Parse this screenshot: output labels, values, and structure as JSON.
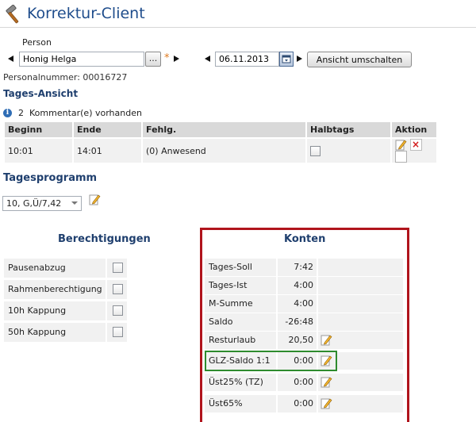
{
  "window": {
    "title": "Korrektur-Client"
  },
  "person": {
    "label": "Person",
    "value": "Honig Helga",
    "lookup_label": "...",
    "required_mark": "*"
  },
  "date": {
    "value": "06.11.2013"
  },
  "toggle_view_label": "Ansicht umschalten",
  "personnel_number": "Personalnummer: 00016727",
  "day_view": {
    "heading": "Tages-Ansicht",
    "info_icon_glyph": "i",
    "comment_count": "2",
    "comment_text": "Kommentar(e) vorhanden",
    "columns": [
      "Beginn",
      "Ende",
      "Fehlg.",
      "Halbtags",
      "Aktion"
    ],
    "rows": [
      {
        "begin": "10:01",
        "end": "14:01",
        "absence": "(0) Anwesend",
        "half_day": false
      }
    ]
  },
  "program": {
    "heading": "Tagesprogramm",
    "selected": "10, G,Ü/7,42"
  },
  "permissions": {
    "heading": "Berechtigungen",
    "items": [
      {
        "label": "Pausenabzug",
        "checked": false
      },
      {
        "label": "Rahmenberechtigung",
        "checked": false
      },
      {
        "label": "10h Kappung",
        "checked": false
      },
      {
        "label": "50h Kappung",
        "checked": false
      }
    ]
  },
  "accounts": {
    "heading": "Konten",
    "items": [
      {
        "label": "Tages-Soll",
        "value": "7:42",
        "editable": false
      },
      {
        "label": "Tages-Ist",
        "value": "4:00",
        "editable": false
      },
      {
        "label": "M-Summe",
        "value": "4:00",
        "editable": false
      },
      {
        "label": "Saldo",
        "value": "-26:48",
        "editable": false
      },
      {
        "label": "Resturlaub",
        "value": "20,50",
        "editable": true
      },
      {
        "label": "GLZ-Saldo 1:1",
        "value": "0:00",
        "editable": true
      },
      {
        "label": "Üst25% (TZ)",
        "value": "0:00",
        "editable": true
      },
      {
        "label": "Üst65%",
        "value": "0:00",
        "editable": true
      }
    ]
  },
  "colors": {
    "title": "#1f4d8c",
    "heading": "#1f3f6e",
    "frame_red": "#b0141c",
    "highlight_green": "#2e8b2e",
    "required_star": "#e07a1e",
    "delete_red": "#d21b1b"
  },
  "icons": {
    "title_icon": "hammer-icon",
    "edit": "edit-pencil-icon",
    "delete": "delete-x-icon",
    "document": "document-icon",
    "calendar": "calendar-icon",
    "info": "info-icon"
  }
}
